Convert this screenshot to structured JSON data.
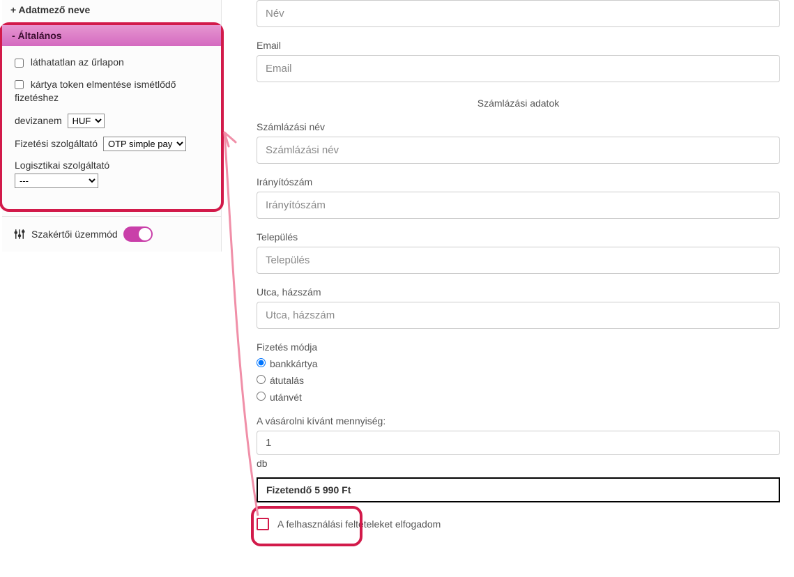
{
  "sidebar": {
    "addFieldLabel": "+ Adatmező neve",
    "generalHeader": "- Általános",
    "invisibleLabel": "láthatatlan az űrlapon",
    "tokenLabel": "kártya token elmentése ismétlődő fizetéshez",
    "currencyLabel": "devizanem",
    "currencyValue": "HUF",
    "providerLabel": "Fizetési szolgáltató",
    "providerValue": "OTP simple pay",
    "logisticsLabel": "Logisztikai szolgáltató",
    "logisticsValue": "---",
    "expertLabel": "Szakértői üzemmód"
  },
  "form": {
    "namePlaceholder": "Név",
    "emailLabel": "Email",
    "emailPlaceholder": "Email",
    "billingHeader": "Számlázási adatok",
    "billingNameLabel": "Számlázási név",
    "billingNamePlaceholder": "Számlázási név",
    "zipLabel": "Irányítószám",
    "zipPlaceholder": "Irányítószám",
    "cityLabel": "Település",
    "cityPlaceholder": "Település",
    "streetLabel": "Utca, házszám",
    "streetPlaceholder": "Utca, házszám",
    "payMethodLabel": "Fizetés módja",
    "payOptions": {
      "card": "bankkártya",
      "transfer": "átutalás",
      "cod": "utánvét"
    },
    "qtyLabel": "A vásárolni kívánt mennyiség:",
    "qtyValue": "1",
    "qtyUnit": "db",
    "totalText": "Fizetendő 5 990 Ft",
    "termsLabel": "A felhasználási feltételeket elfogadom"
  }
}
